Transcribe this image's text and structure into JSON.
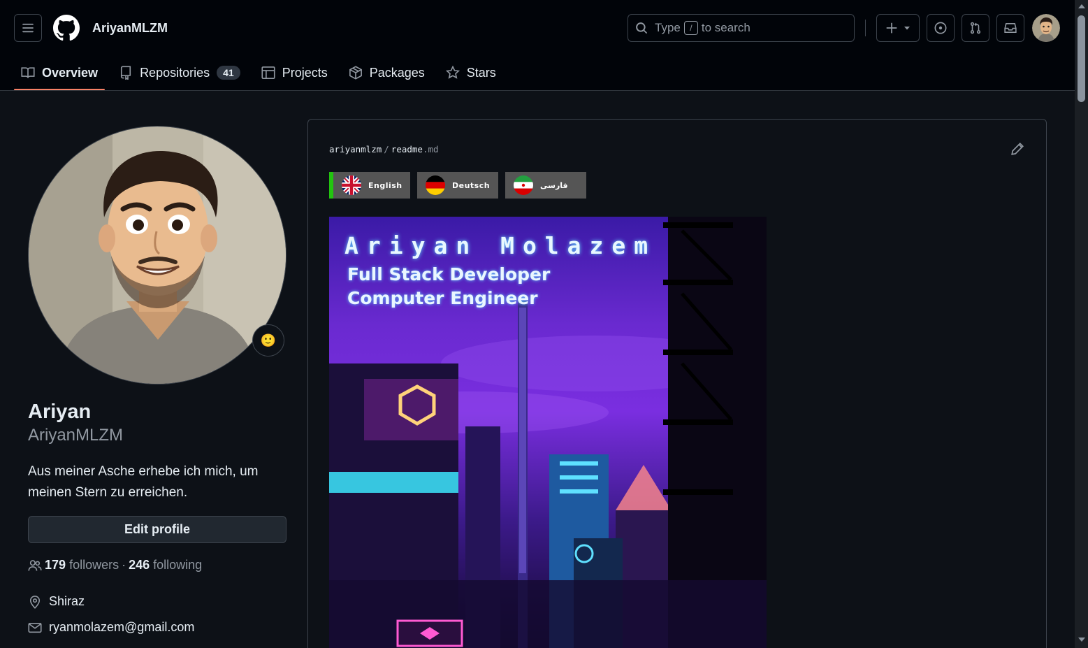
{
  "header": {
    "username": "AriyanMLZM",
    "search": {
      "prefix": "Type",
      "key": "/",
      "suffix": "to search"
    }
  },
  "tabs": [
    {
      "label": "Overview",
      "icon": "book-icon",
      "active": true
    },
    {
      "label": "Repositories",
      "icon": "repo-icon",
      "count": "41"
    },
    {
      "label": "Projects",
      "icon": "table-icon"
    },
    {
      "label": "Packages",
      "icon": "package-icon"
    },
    {
      "label": "Stars",
      "icon": "star-icon"
    }
  ],
  "profile": {
    "display_name": "Ariyan",
    "login": "AriyanMLZM",
    "bio": "Aus meiner Asche erhebe ich mich, um meinen Stern zu erreichen.",
    "edit_label": "Edit profile",
    "followers_count": "179",
    "followers_label": "followers",
    "separator": "·",
    "following_count": "246",
    "following_label": "following",
    "location": "Shiraz",
    "email": "ryanmolazem@gmail.com",
    "status_emoji": "🙂"
  },
  "readme": {
    "owner": "ariyanmlzm",
    "file": "readme",
    "ext": ".md",
    "languages": [
      {
        "label": "English",
        "flag": "uk-flag"
      },
      {
        "label": "Deutsch",
        "flag": "germany-flag"
      },
      {
        "label": "فارسی",
        "flag": "iran-flag"
      }
    ],
    "banner": {
      "name": "Ariyan Molazem",
      "line1": "Full Stack Developer",
      "line2": "Computer Engineer"
    }
  },
  "colors": {
    "background": "#0d1117",
    "header": "#010409",
    "border": "#3d444d",
    "accent_underline": "#f78166",
    "english_marker": "#22c40f"
  }
}
